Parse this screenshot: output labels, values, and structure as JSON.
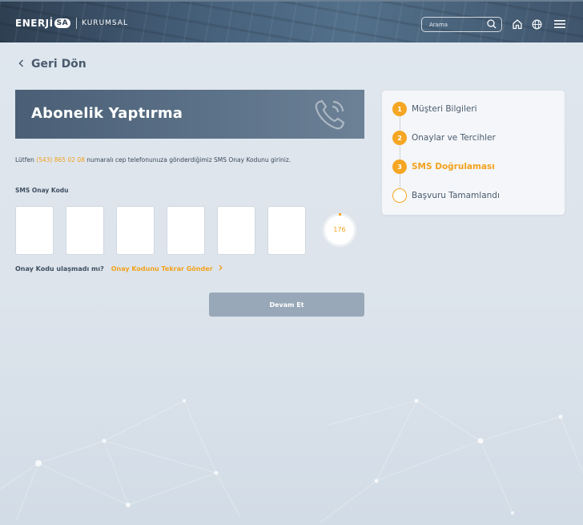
{
  "header": {
    "logo_brand": "ENERJİ",
    "logo_sa": "SA",
    "logo_sub": "KURUMSAL",
    "search_placeholder": "Arama",
    "icons": [
      "search-icon",
      "home-icon",
      "globe-icon",
      "menu-icon"
    ]
  },
  "nav": {
    "back_label": "Geri Dön"
  },
  "banner": {
    "title": "Abonelik Yaptırma",
    "icon": "phone-icon"
  },
  "instruction": {
    "prefix": "Lütfen",
    "phone": "(543) 865 02 08",
    "suffix": "numaralı cep telefonunuza gönderdiğimiz SMS Onay Kodunu giriniz."
  },
  "sms": {
    "label": "SMS Onay Kodu",
    "code_values": [
      "",
      "",
      "",
      "",
      "",
      ""
    ],
    "timer": "176"
  },
  "resend": {
    "question": "Onay Kodu ulaşmadı mı?",
    "link": "Onay Kodunu Tekrar Gönder"
  },
  "actions": {
    "continue_label": "Devam Et"
  },
  "steps": {
    "items": [
      {
        "number": "1",
        "label": "Müşteri Bilgileri",
        "state": "done"
      },
      {
        "number": "2",
        "label": "Onaylar ve Tercihler",
        "state": "done"
      },
      {
        "number": "3",
        "label": "SMS Doğrulaması",
        "state": "active"
      },
      {
        "number": "",
        "label": "Başvuru Tamamlandı",
        "state": "pending"
      }
    ]
  },
  "colors": {
    "accent": "#f5a623",
    "banner": "#53697f",
    "button": "#98a8b8"
  }
}
